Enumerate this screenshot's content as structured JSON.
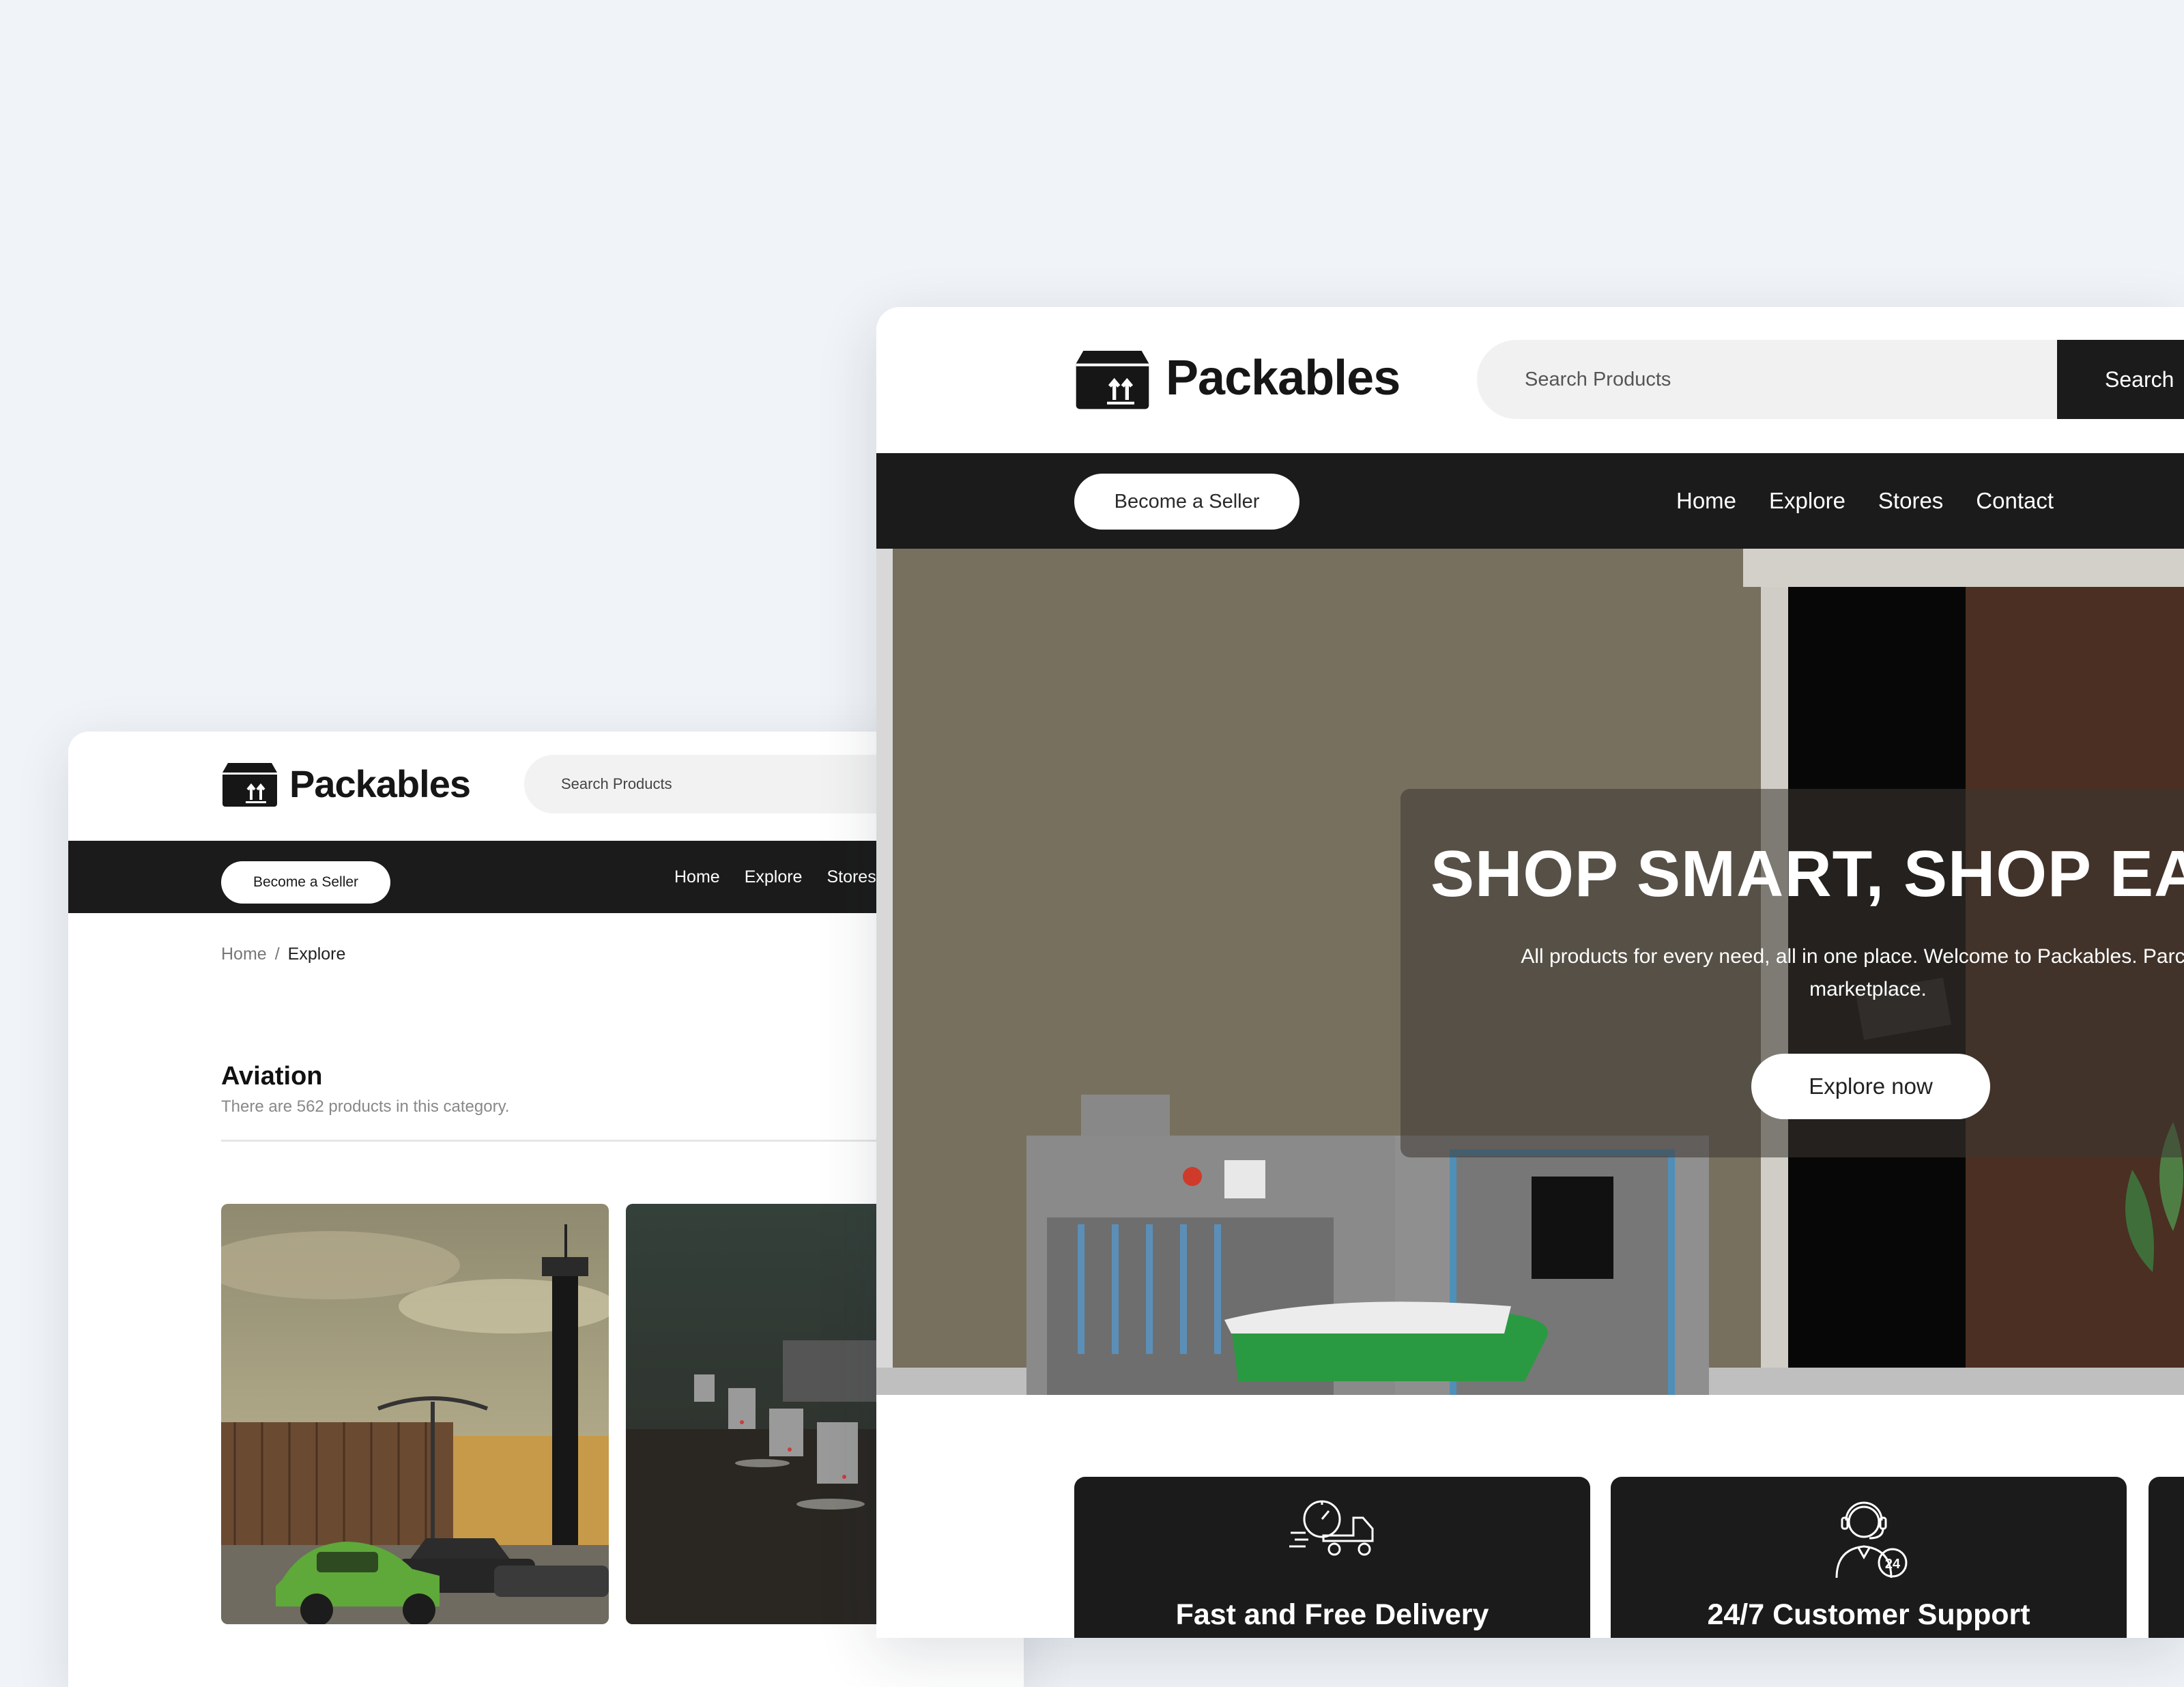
{
  "brand": {
    "name": "Packables"
  },
  "back_window": {
    "search": {
      "placeholder": "Search Products"
    },
    "seller_button": "Become a Seller",
    "nav": [
      "Home",
      "Explore",
      "Stores"
    ],
    "breadcrumb": {
      "home": "Home",
      "separator": "/",
      "current": "Explore"
    },
    "category": {
      "title": "Aviation",
      "count_text": "There are 562 products in this category."
    }
  },
  "front_window": {
    "search": {
      "placeholder": "Search Products",
      "button": "Search"
    },
    "seller_button": "Become a Seller",
    "nav": [
      "Home",
      "Explore",
      "Stores",
      "Contact"
    ],
    "hero": {
      "title": "SHOP SMART, SHOP EA",
      "subtitle_line1": "All products for every need, all in one place. Welcome to Packables. Parcel's",
      "subtitle_line2": "marketplace.",
      "cta": "Explore now"
    },
    "features": [
      {
        "title": "Fast and Free Delivery",
        "icon": "delivery-truck-icon"
      },
      {
        "title": "24/7 Customer Support",
        "icon": "customer-support-icon"
      }
    ]
  },
  "colors": {
    "background": "#f0f3f7",
    "dark": "#1b1b1b",
    "accent_green": "#1f8f3a"
  }
}
